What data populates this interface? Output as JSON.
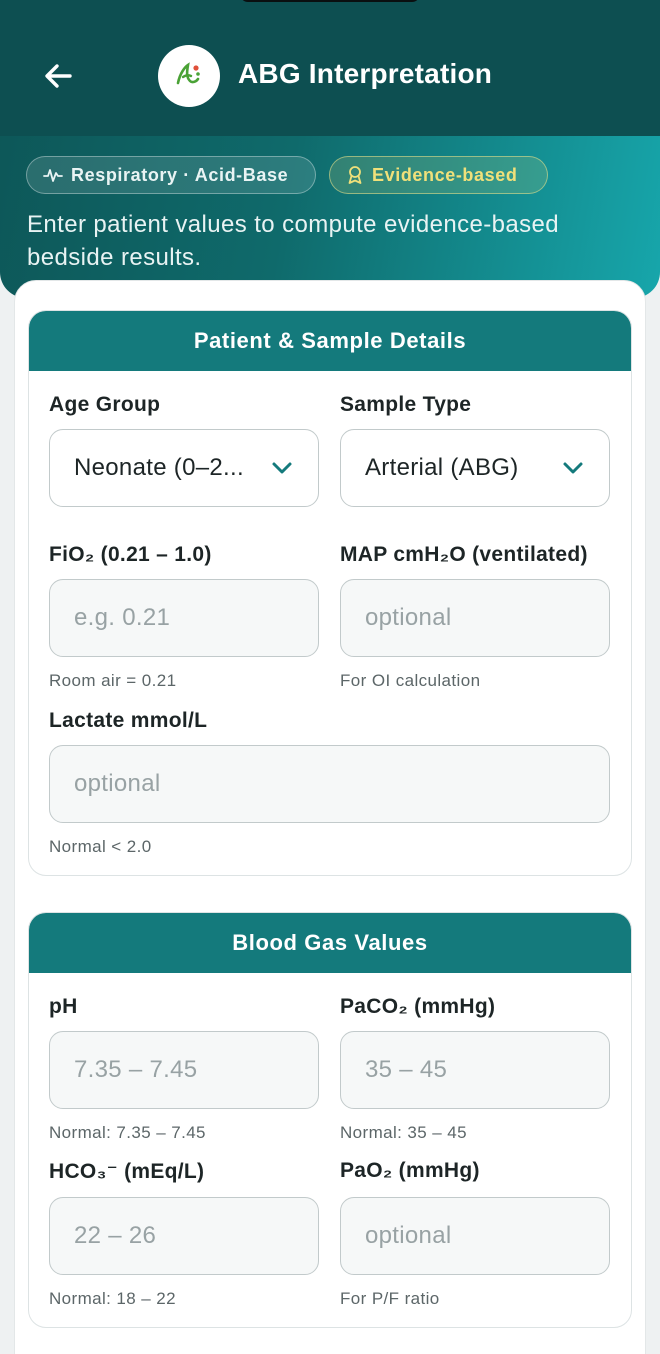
{
  "header": {
    "title": "ABG Interpretation",
    "back_icon": "arrow-left-icon",
    "logo_icon": "app-logo-icon",
    "chips": [
      {
        "label": "Respiratory · Acid-Base",
        "icon": "pulse-icon"
      },
      {
        "label": "Evidence-based",
        "icon": "award-ribbon-icon"
      }
    ],
    "subtitle": "Enter patient values to compute evidence-based bedside results."
  },
  "patient_card": {
    "title": "Patient & Sample Details",
    "age_group": {
      "label": "Age Group",
      "value": "Neonate (0–2..."
    },
    "sample_type": {
      "label": "Sample Type",
      "value": "Arterial (ABG)"
    },
    "fio2": {
      "label": "FiO₂ (0.21 – 1.0)",
      "placeholder": "e.g. 0.21",
      "hint": "Room air = 0.21"
    },
    "map": {
      "label": "MAP cmH₂O (ventilated)",
      "placeholder": "optional",
      "hint": "For OI calculation"
    },
    "lactate": {
      "label": "Lactate mmol/L",
      "placeholder": "optional",
      "hint": "Normal < 2.0"
    }
  },
  "blood_gas_card": {
    "title": "Blood Gas Values",
    "ph": {
      "label": "pH",
      "placeholder": "7.35 – 7.45",
      "hint": "Normal: 7.35 – 7.45"
    },
    "paco2": {
      "label": "PaCO₂ (mmHg)",
      "placeholder": "35 – 45",
      "hint": "Normal: 35 – 45"
    },
    "hco3": {
      "label": "HCO₃⁻ (mEq/L)",
      "placeholder": "22 – 26",
      "hint": "Normal: 18 – 22"
    },
    "pao2": {
      "label": "PaO₂ (mmHg)",
      "placeholder": "optional",
      "hint": "For P/F ratio"
    }
  },
  "colors": {
    "header_dark": "#0d4f51",
    "header_accent": "#17a6ab",
    "card_header": "#147a7c",
    "evidence_chip_text": "#f0e07a"
  }
}
